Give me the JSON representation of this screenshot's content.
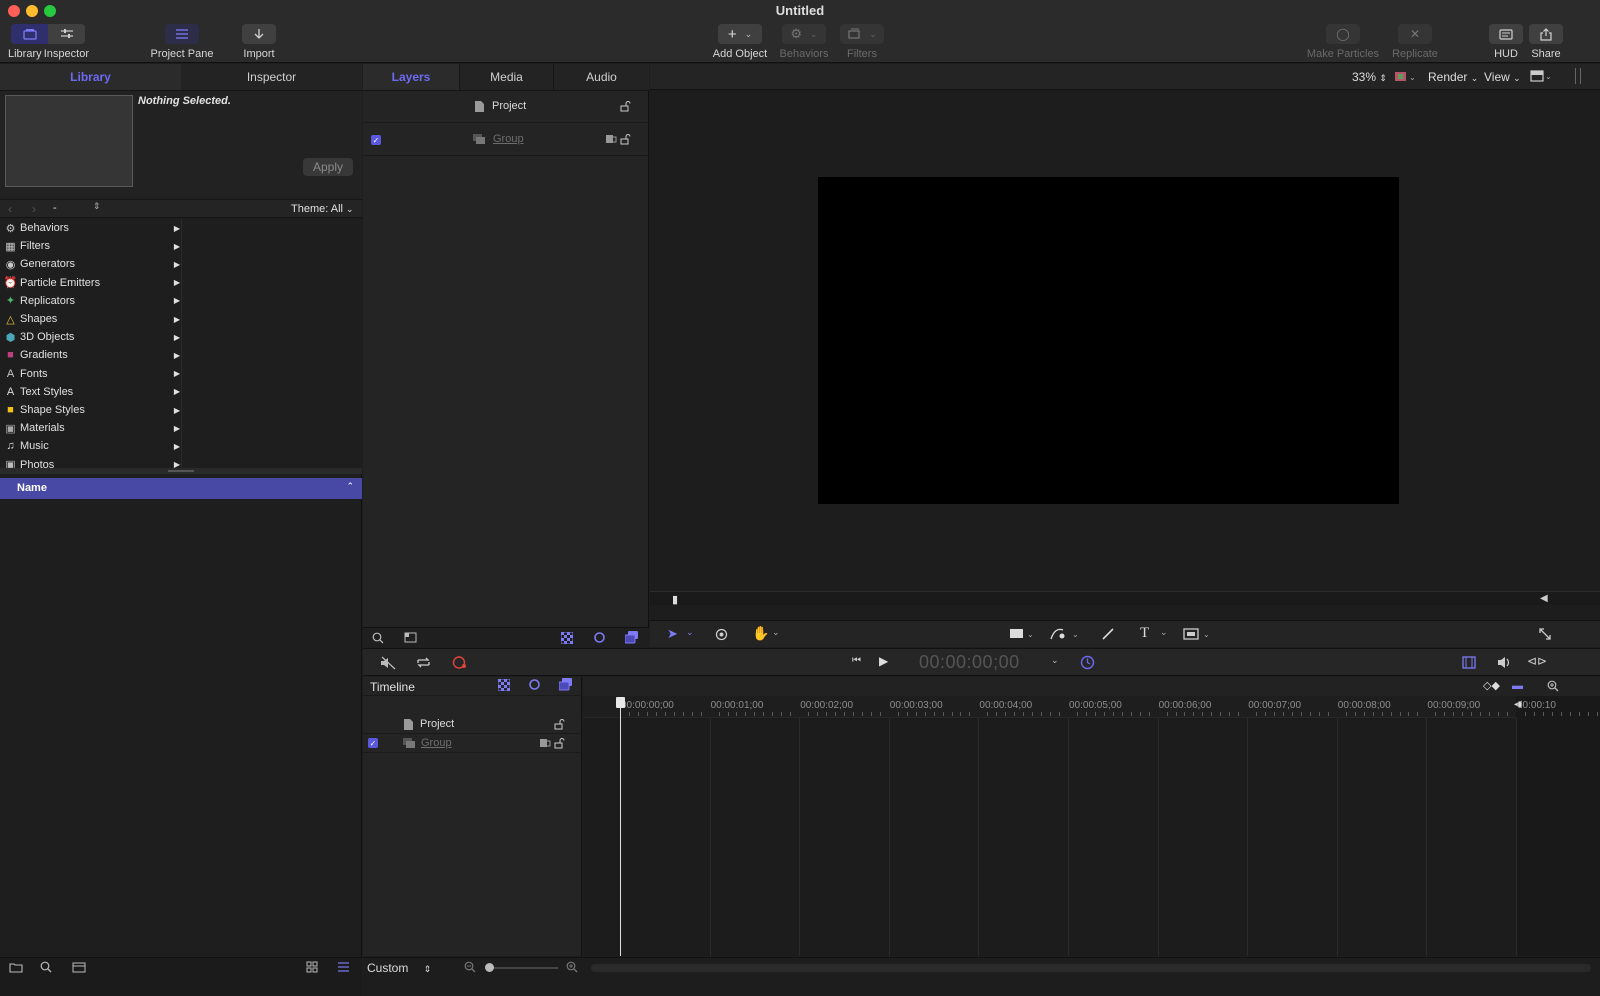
{
  "window": {
    "title": "Untitled"
  },
  "toolbar": {
    "library": "Library",
    "inspector": "Inspector",
    "project_pane": "Project Pane",
    "import": "Import",
    "add_object": "Add Object",
    "behaviors": "Behaviors",
    "filters": "Filters",
    "make_particles": "Make Particles",
    "replicate": "Replicate",
    "hud": "HUD",
    "share": "Share"
  },
  "left_tabs": {
    "library": "Library",
    "inspector": "Inspector"
  },
  "preview": {
    "status": "Nothing Selected.",
    "apply": "Apply"
  },
  "browser": {
    "path": "-",
    "theme": "Theme: All"
  },
  "categories": [
    {
      "label": "Behaviors",
      "icon": "gear-icon"
    },
    {
      "label": "Filters",
      "icon": "film-icon"
    },
    {
      "label": "Generators",
      "icon": "generator-icon"
    },
    {
      "label": "Particle Emitters",
      "icon": "alarm-icon"
    },
    {
      "label": "Replicators",
      "icon": "replicator-icon"
    },
    {
      "label": "Shapes",
      "icon": "shape-icon"
    },
    {
      "label": "3D Objects",
      "icon": "cube-icon"
    },
    {
      "label": "Gradients",
      "icon": "gradient-icon"
    },
    {
      "label": "Fonts",
      "icon": "font-icon"
    },
    {
      "label": "Text Styles",
      "icon": "text-style-icon"
    },
    {
      "label": "Shape Styles",
      "icon": "shape-style-icon"
    },
    {
      "label": "Materials",
      "icon": "material-icon"
    },
    {
      "label": "Music",
      "icon": "music-icon"
    },
    {
      "label": "Photos",
      "icon": "photo-icon"
    }
  ],
  "list_header": {
    "name": "Name"
  },
  "mid_tabs": {
    "layers": "Layers",
    "media": "Media",
    "audio": "Audio"
  },
  "layers": {
    "project": "Project",
    "group": "Group"
  },
  "canvas_bar": {
    "zoom": "33%",
    "render": "Render",
    "view": "View"
  },
  "transport": {
    "timecode": "00:00:00;00"
  },
  "timeline": {
    "title": "Timeline",
    "project": "Project",
    "group": "Group",
    "ruler": [
      "00:00:00;00",
      "00:00:01;00",
      "00:00:02;00",
      "00:00:03;00",
      "00:00:04;00",
      "00:00:05;00",
      "00:00:06;00",
      "00:00:07;00",
      "00:00:08;00",
      "00:00:09;00",
      "00:00:10"
    ]
  },
  "bottom": {
    "custom": "Custom"
  },
  "colors": {
    "accent": "#5a59e0",
    "record": "#e0443a"
  }
}
